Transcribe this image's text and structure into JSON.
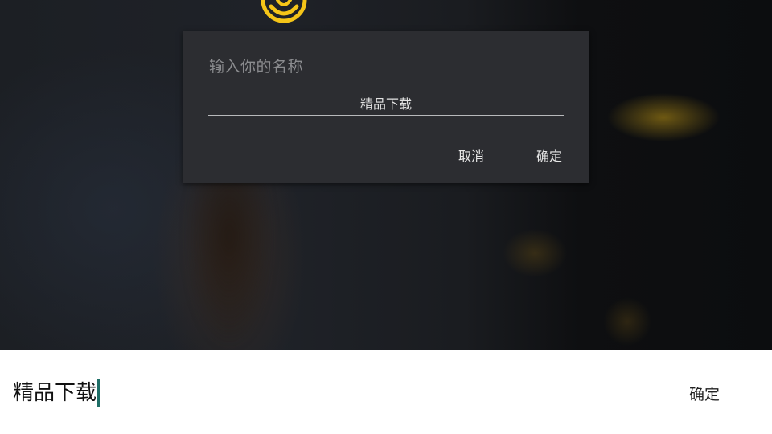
{
  "dialog": {
    "title": "输入你的名称",
    "input_value": "精品下载",
    "cancel_label": "取消",
    "confirm_label": "确定"
  },
  "ime_bar": {
    "input_value": "精品下载",
    "confirm_label": "确定"
  },
  "colors": {
    "dialog_bg": "#2c2d31",
    "accent_yellow": "#f5c518",
    "caret": "#1f6f67"
  },
  "icons": {
    "logo": "game-logo-icon"
  }
}
